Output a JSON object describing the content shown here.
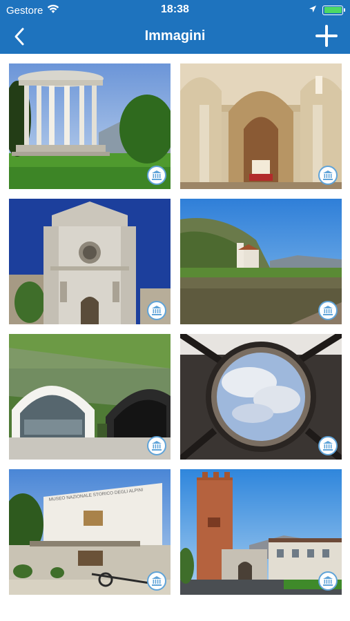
{
  "status_bar": {
    "carrier": "Gestore",
    "time": "18:38",
    "battery_level": 1.0,
    "battery_color": "#4cd964"
  },
  "nav": {
    "title": "Immagini",
    "back_icon": "chevron-left-icon",
    "add_icon": "plus-icon",
    "background_color": "#1e73be"
  },
  "gallery": {
    "badge_icon": "museum-icon",
    "badge_color": "#5fa3d8",
    "images": [
      {
        "subject": "round-colonnade-monument"
      },
      {
        "subject": "church-interior-arches"
      },
      {
        "subject": "church-facade-rose-window"
      },
      {
        "subject": "river-with-church"
      },
      {
        "subject": "tunnel-entrances"
      },
      {
        "subject": "circular-skylight"
      },
      {
        "subject": "alpini-museum-building"
      },
      {
        "subject": "medieval-tower-gate"
      }
    ]
  },
  "museum_sign_text": "MUSEO NAZIONALE STORICO DEGLI ALPINI"
}
